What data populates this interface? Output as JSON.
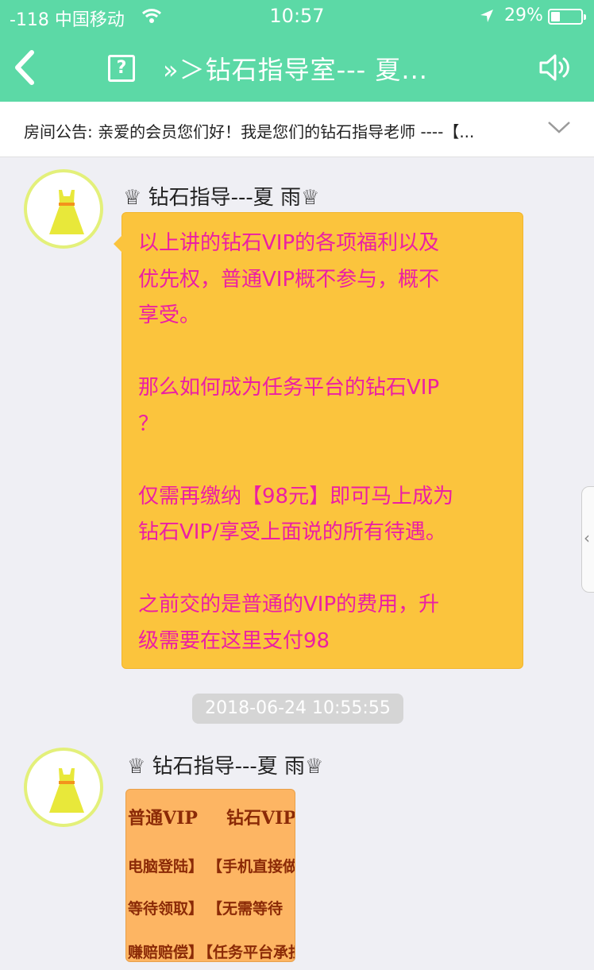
{
  "status_bar": {
    "signal": "-118 中国移动",
    "time": "10:57",
    "battery_pct": "29%"
  },
  "nav": {
    "help_symbol": "?",
    "title": "»＞钻石指导室---  夏..."
  },
  "notice": {
    "text": "房间公告: 亲爱的会员您们好！我是您们的钻石指导老师 ----【..."
  },
  "messages": [
    {
      "sender": "♕ 钻石指导---夏   雨♕",
      "paragraphs": [
        [
          "以上讲的钻石VIP的各项福利以及",
          "优先权，普通VIP概不参与，概不",
          "享受。"
        ],
        [
          "那么如何成为任务平台的钻石VIP",
          "？"
        ],
        [
          "仅需再缴纳【98元】即可马上成为",
          "钻石VIP/享受上面说的所有待遇。"
        ],
        [
          "之前交的是普通的VIP的费用，升",
          "级需要在这里支付98"
        ]
      ]
    }
  ],
  "timestamp": "2018-06-24 10:55:55",
  "image_message": {
    "sender": "♕ 钻石指导---夏   雨♕",
    "image_text": {
      "header_left": "普通VIP",
      "header_right": "钻石VIP",
      "row1_left": "电脑登陆】",
      "row1_right": "【手机直接做",
      "row2_left": "等待领取】",
      "row2_right": "【无需等待",
      "row3_left": "赚赔赔偿】",
      "row3_right": "【任务平台承担"
    }
  },
  "side_handle": "‹",
  "colors": {
    "header_bg": "#5cd9a6",
    "bubble_bg": "#fbc43d",
    "message_text": "#ec1ea4",
    "avatar_ring": "#e3f07a",
    "page_bg": "#efeff4"
  }
}
